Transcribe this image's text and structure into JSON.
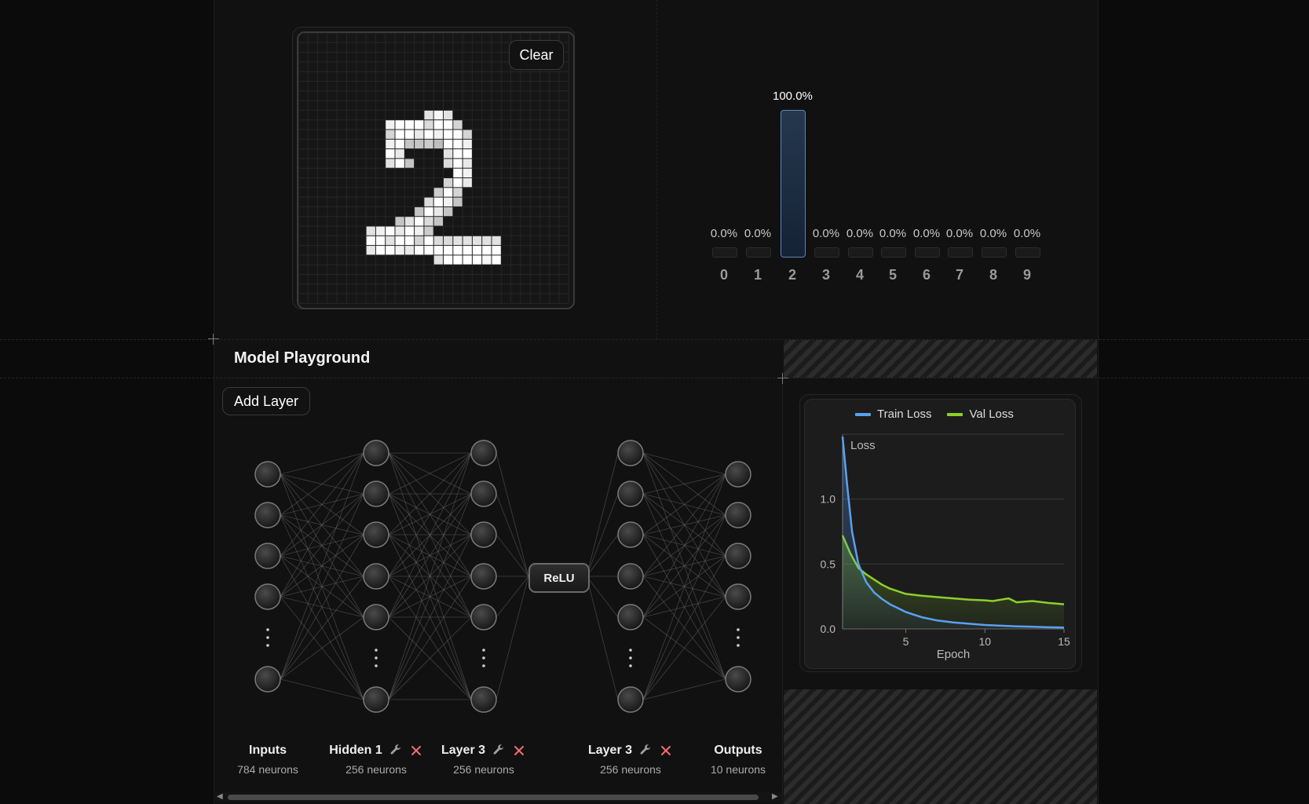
{
  "canvas": {
    "clear_label": "Clear",
    "grid_size": 28,
    "pixels": [
      [
        13,
        8,
        0.8
      ],
      [
        14,
        8,
        0.95
      ],
      [
        15,
        8,
        0.8
      ],
      [
        9,
        9,
        0.9
      ],
      [
        10,
        9,
        1
      ],
      [
        11,
        9,
        1
      ],
      [
        12,
        9,
        1
      ],
      [
        13,
        9,
        0.75
      ],
      [
        14,
        9,
        1
      ],
      [
        15,
        9,
        1
      ],
      [
        16,
        9,
        0.7
      ],
      [
        9,
        10,
        0.7
      ],
      [
        10,
        10,
        1
      ],
      [
        11,
        10,
        1
      ],
      [
        12,
        10,
        0.85
      ],
      [
        13,
        10,
        1
      ],
      [
        14,
        10,
        0.9
      ],
      [
        15,
        10,
        1
      ],
      [
        16,
        10,
        1
      ],
      [
        17,
        10,
        0.7
      ],
      [
        9,
        11,
        0.9
      ],
      [
        10,
        11,
        1
      ],
      [
        11,
        11,
        0.6
      ],
      [
        12,
        11,
        0.6
      ],
      [
        13,
        11,
        0.65
      ],
      [
        14,
        11,
        0.55
      ],
      [
        15,
        11,
        1
      ],
      [
        16,
        11,
        1
      ],
      [
        17,
        11,
        0.9
      ],
      [
        9,
        12,
        1
      ],
      [
        10,
        12,
        0.85
      ],
      [
        15,
        12,
        0.8
      ],
      [
        16,
        12,
        1
      ],
      [
        17,
        12,
        1
      ],
      [
        9,
        13,
        0.8
      ],
      [
        10,
        13,
        1
      ],
      [
        11,
        13,
        0.6
      ],
      [
        15,
        13,
        0.75
      ],
      [
        16,
        13,
        1
      ],
      [
        17,
        13,
        0.85
      ],
      [
        16,
        14,
        1
      ],
      [
        17,
        14,
        0.9
      ],
      [
        15,
        15,
        0.7
      ],
      [
        16,
        15,
        1
      ],
      [
        17,
        15,
        0.85
      ],
      [
        14,
        16,
        0.65
      ],
      [
        15,
        16,
        1
      ],
      [
        16,
        16,
        0.7
      ],
      [
        13,
        17,
        0.75
      ],
      [
        14,
        17,
        1
      ],
      [
        15,
        17,
        0.9
      ],
      [
        16,
        17,
        0.6
      ],
      [
        12,
        18,
        0.6
      ],
      [
        13,
        18,
        1
      ],
      [
        14,
        18,
        0.85
      ],
      [
        15,
        18,
        0.6
      ],
      [
        10,
        19,
        0.6
      ],
      [
        11,
        19,
        0.8
      ],
      [
        12,
        19,
        1
      ],
      [
        13,
        19,
        0.75
      ],
      [
        14,
        19,
        0.6
      ],
      [
        7,
        20,
        0.8
      ],
      [
        8,
        20,
        0.9
      ],
      [
        9,
        20,
        1
      ],
      [
        10,
        20,
        0.85
      ],
      [
        11,
        20,
        1
      ],
      [
        12,
        20,
        0.9
      ],
      [
        13,
        20,
        0.65
      ],
      [
        7,
        21,
        1
      ],
      [
        8,
        21,
        1
      ],
      [
        9,
        21,
        0.8
      ],
      [
        10,
        21,
        1
      ],
      [
        11,
        21,
        1
      ],
      [
        12,
        21,
        0.7
      ],
      [
        13,
        21,
        1
      ],
      [
        14,
        21,
        0.75
      ],
      [
        15,
        21,
        0.75
      ],
      [
        16,
        21,
        0.8
      ],
      [
        17,
        21,
        0.8
      ],
      [
        18,
        21,
        0.8
      ],
      [
        19,
        21,
        0.8
      ],
      [
        20,
        21,
        0.8
      ],
      [
        7,
        22,
        0.85
      ],
      [
        8,
        22,
        1
      ],
      [
        9,
        22,
        1
      ],
      [
        10,
        22,
        0.9
      ],
      [
        11,
        22,
        0.85
      ],
      [
        12,
        22,
        1
      ],
      [
        13,
        22,
        1
      ],
      [
        14,
        22,
        1
      ],
      [
        15,
        22,
        1
      ],
      [
        16,
        22,
        1
      ],
      [
        17,
        22,
        1
      ],
      [
        18,
        22,
        1
      ],
      [
        19,
        22,
        1
      ],
      [
        20,
        22,
        1
      ],
      [
        14,
        23,
        0.8
      ],
      [
        15,
        23,
        1
      ],
      [
        16,
        23,
        1
      ],
      [
        17,
        23,
        1
      ],
      [
        18,
        23,
        1
      ],
      [
        19,
        23,
        0.95
      ],
      [
        20,
        23,
        1
      ]
    ]
  },
  "prediction": {
    "digits": [
      "0",
      "1",
      "2",
      "3",
      "4",
      "5",
      "6",
      "7",
      "8",
      "9"
    ],
    "percent_labels": [
      "0.0%",
      "0.0%",
      "100.0%",
      "0.0%",
      "0.0%",
      "0.0%",
      "0.0%",
      "0.0%",
      "0.0%",
      "0.0%"
    ],
    "probabilities": [
      0,
      0,
      1,
      0,
      0,
      0,
      0,
      0,
      0,
      0
    ],
    "bar_color": "#5c86b8"
  },
  "playground": {
    "title": "Model Playground",
    "add_layer_label": "Add Layer",
    "activation_label": "ReLU",
    "layers": [
      {
        "name": "Inputs",
        "neurons": "784 neurons",
        "editable": false
      },
      {
        "name": "Hidden 1",
        "neurons": "256 neurons",
        "editable": true
      },
      {
        "name": "Layer 3",
        "neurons": "256 neurons",
        "editable": true
      },
      {
        "name": "Layer 3",
        "neurons": "256 neurons",
        "editable": true
      },
      {
        "name": "Outputs",
        "neurons": "10 neurons",
        "editable": false
      }
    ],
    "icons": {
      "edit": "wrench-icon",
      "remove": "close-icon"
    },
    "remove_color": "#f26d6d"
  },
  "chart_data": {
    "type": "line",
    "title": "",
    "xlabel": "Epoch",
    "ylabel": "Loss",
    "xlim": [
      1,
      15
    ],
    "ylim": [
      0,
      1.5
    ],
    "xticks": [
      5,
      10,
      15
    ],
    "yticks": [
      0.0,
      0.5,
      1.0
    ],
    "ytick_labels": [
      "0.0",
      "0.5",
      "1.0"
    ],
    "grid": true,
    "legend_position": "top",
    "series": [
      {
        "name": "Train Loss",
        "color": "#5aa0f0",
        "x": [
          1,
          1.3,
          1.6,
          2,
          2.5,
          3,
          3.5,
          4,
          5,
          6,
          7,
          8,
          9,
          10,
          11,
          12,
          13,
          14,
          15
        ],
        "y": [
          1.48,
          1.1,
          0.75,
          0.5,
          0.36,
          0.28,
          0.23,
          0.19,
          0.13,
          0.09,
          0.065,
          0.05,
          0.04,
          0.03,
          0.025,
          0.02,
          0.017,
          0.013,
          0.01
        ]
      },
      {
        "name": "Val Loss",
        "color": "#8bd02a",
        "x": [
          1,
          1.5,
          2,
          2.5,
          3,
          3.5,
          4,
          5,
          6,
          7,
          8,
          9,
          10,
          10.5,
          11,
          11.5,
          12,
          12.5,
          13,
          14,
          15
        ],
        "y": [
          0.72,
          0.58,
          0.47,
          0.42,
          0.38,
          0.34,
          0.31,
          0.27,
          0.255,
          0.245,
          0.235,
          0.225,
          0.22,
          0.215,
          0.225,
          0.235,
          0.205,
          0.21,
          0.215,
          0.2,
          0.19
        ]
      }
    ]
  }
}
